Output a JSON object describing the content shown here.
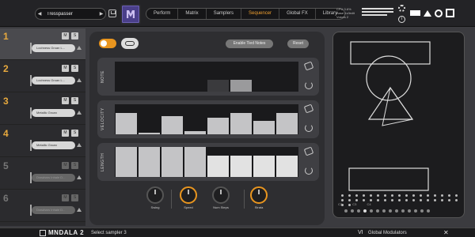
{
  "header": {
    "preset_name": "Tresspasser",
    "prev_arrow": "◀",
    "next_arrow": "▶",
    "tabs": [
      {
        "label": "Perform",
        "active": false
      },
      {
        "label": "Matrix",
        "active": false
      },
      {
        "label": "Samplers",
        "active": false
      },
      {
        "label": "Sequencer",
        "active": true
      },
      {
        "label": "Global FX",
        "active": false
      },
      {
        "label": "Library",
        "active": false
      }
    ],
    "cpu_lines": [
      "CPU 3.6%",
      "Base 1x/ledit",
      "Voices 2"
    ]
  },
  "samplers": [
    {
      "num": "1",
      "sample": "Lochness Groan L...",
      "dim": false,
      "selected": true
    },
    {
      "num": "2",
      "sample": "Lochness Groan L...",
      "dim": false,
      "selected": false
    },
    {
      "num": "3",
      "sample": "Metallic Groan",
      "dim": false,
      "selected": false
    },
    {
      "num": "4",
      "sample": "Metallic Groan",
      "dim": false,
      "selected": false
    },
    {
      "num": "5",
      "sample": "Drawbars Inhale D...",
      "dim": true,
      "selected": false
    },
    {
      "num": "6",
      "sample": "Drawbars Inhale D...",
      "dim": true,
      "selected": false
    }
  ],
  "slot_buttons": {
    "mute": "M",
    "solo": "S"
  },
  "sequencer": {
    "enable_tied_notes_label": "Enable Tied Notes",
    "reset_label": "Reset",
    "lanes": [
      {
        "label": "NOTE",
        "values": [
          0,
          0,
          0,
          0,
          0,
          0,
          0,
          0
        ],
        "highlight": [
          0,
          0,
          0,
          0,
          0.4,
          0.4,
          0,
          0
        ]
      },
      {
        "label": "VELOCITY",
        "values": [
          0.7,
          0.05,
          0.6,
          0.1,
          0.55,
          0.7,
          0.45,
          0.7
        ]
      },
      {
        "label": "LENGTH",
        "values": [
          1,
          1,
          1,
          1,
          0.7,
          0.7,
          0.7,
          0.7
        ]
      }
    ],
    "knobs": [
      {
        "label": "Swing",
        "color": "grey"
      },
      {
        "label": "Speed",
        "color": "orange"
      },
      {
        "label": "Num Steps",
        "color": "grey"
      },
      {
        "label": "Strata",
        "color": "orange"
      }
    ]
  },
  "modpanel": {
    "notes": "C2 C3 C4"
  },
  "footer": {
    "brand": "MNDALA 2",
    "status": "Select sampler 3",
    "modulators_label": "Global Modulators",
    "close": "✕"
  },
  "colors": {
    "accent": "#e8951f",
    "slot_number": "#e7a93e"
  }
}
